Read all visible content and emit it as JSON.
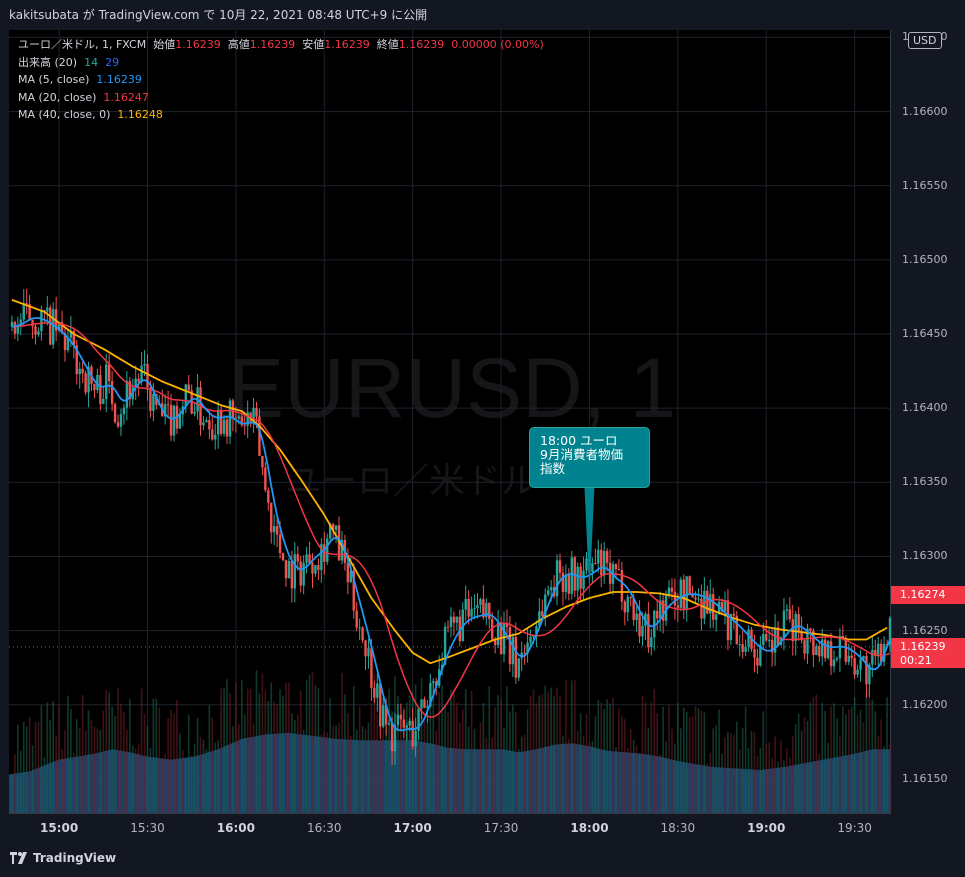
{
  "header": {
    "publish_line": "kakitsubata が TradingView.com で 10月 22, 2021 08:48 UTC+9 に公開"
  },
  "legend": {
    "symbol": "ユーロ／米ドル, 1, FXCM",
    "open_label": "始値",
    "open_value": "1.16239",
    "high_label": "高値",
    "high_value": "1.16239",
    "low_label": "安値",
    "low_value": "1.16239",
    "close_label": "終値",
    "close_value": "1.16239",
    "change_value": "0.00000 (0.00%)",
    "volume_label": "出来高 (20)",
    "volume_value1": "14",
    "volume_value2": "29",
    "ma5_label": "MA (5, close)",
    "ma5_value": "1.16239",
    "ma20_label": "MA (20, close)",
    "ma20_value": "1.16247",
    "ma40_label": "MA (40, close, 0)",
    "ma40_value": "1.16248"
  },
  "watermark": {
    "symbol": "EURUSD, 1",
    "name": "ユーロ／米ドル"
  },
  "annotation": {
    "line1": "18:00 ユーロ",
    "line2": "9月消費者物価",
    "line3": "指数"
  },
  "currency": "USD",
  "price_tags": {
    "last_high": "1.16274",
    "current": "1.16239",
    "countdown": "00:21"
  },
  "brand": {
    "name": "TradingView"
  },
  "colors": {
    "background": "#000000",
    "up": "#26a69a",
    "down": "#ef5350",
    "ma5": "#2196f3",
    "ma20": "#f23645",
    "ma40": "#ffb300",
    "volume_area": "#1e4a78",
    "annotation": "#00838f"
  },
  "chart_data": {
    "type": "candlestick",
    "title": "ユーロ／米ドル, 1, FXCM",
    "x_ticks": [
      "15:00",
      "15:30",
      "16:00",
      "16:30",
      "17:00",
      "17:30",
      "18:00",
      "18:30",
      "19:00",
      "19:30"
    ],
    "y_ticks": [
      "1.16650",
      "1.16600",
      "1.16550",
      "1.16500",
      "1.16450",
      "1.16400",
      "1.16350",
      "1.16300",
      "1.16250",
      "1.16200",
      "1.16150"
    ],
    "ylim": [
      1.16127,
      1.16655
    ],
    "xlim_minutes": [
      -17,
      282
    ],
    "close_path": [
      [
        -16,
        1.16455
      ],
      [
        -10,
        1.16462
      ],
      [
        -5,
        1.16458
      ],
      [
        0,
        1.1645
      ],
      [
        4,
        1.1644
      ],
      [
        8,
        1.16425
      ],
      [
        12,
        1.16412
      ],
      [
        16,
        1.16418
      ],
      [
        20,
        1.164
      ],
      [
        24,
        1.16415
      ],
      [
        28,
        1.16422
      ],
      [
        32,
        1.16402
      ],
      [
        36,
        1.1639
      ],
      [
        40,
        1.16398
      ],
      [
        44,
        1.1641
      ],
      [
        48,
        1.16398
      ],
      [
        52,
        1.16392
      ],
      [
        56,
        1.16396
      ],
      [
        60,
        1.16388
      ],
      [
        64,
        1.16392
      ],
      [
        67,
        1.16385
      ],
      [
        70,
        1.16345
      ],
      [
        74,
        1.1631
      ],
      [
        78,
        1.16292
      ],
      [
        81,
        1.1629
      ],
      [
        85,
        1.163
      ],
      [
        89,
        1.16305
      ],
      [
        92,
        1.16318
      ],
      [
        96,
        1.163
      ],
      [
        100,
        1.1627
      ],
      [
        104,
        1.1624
      ],
      [
        107,
        1.16215
      ],
      [
        110,
        1.1619
      ],
      [
        113,
        1.1618
      ],
      [
        116,
        1.16185
      ],
      [
        120,
        1.16182
      ],
      [
        123,
        1.16195
      ],
      [
        126,
        1.16212
      ],
      [
        129,
        1.1623
      ],
      [
        133,
        1.16248
      ],
      [
        137,
        1.16258
      ],
      [
        141,
        1.1626
      ],
      [
        145,
        1.16262
      ],
      [
        149,
        1.1625
      ],
      [
        152,
        1.1624
      ],
      [
        155,
        1.16228
      ],
      [
        159,
        1.16242
      ],
      [
        163,
        1.16262
      ],
      [
        167,
        1.16282
      ],
      [
        171,
        1.1629
      ],
      [
        175,
        1.16285
      ],
      [
        179,
        1.16288
      ],
      [
        183,
        1.16295
      ],
      [
        187,
        1.16285
      ],
      [
        191,
        1.1628
      ],
      [
        194,
        1.16268
      ],
      [
        197,
        1.16255
      ],
      [
        200,
        1.1625
      ],
      [
        204,
        1.16265
      ],
      [
        208,
        1.16272
      ],
      [
        212,
        1.16275
      ],
      [
        216,
        1.16274
      ],
      [
        220,
        1.1627
      ],
      [
        224,
        1.16262
      ],
      [
        228,
        1.16255
      ],
      [
        232,
        1.16247
      ],
      [
        236,
        1.16238
      ],
      [
        240,
        1.16235
      ],
      [
        244,
        1.16245
      ],
      [
        248,
        1.16255
      ],
      [
        252,
        1.1625
      ],
      [
        256,
        1.16242
      ],
      [
        260,
        1.16238
      ],
      [
        264,
        1.1624
      ],
      [
        268,
        1.16236
      ],
      [
        272,
        1.16228
      ],
      [
        275,
        1.1622
      ],
      [
        278,
        1.16232
      ],
      [
        281,
        1.16252
      ]
    ],
    "ma40_path": [
      [
        -16,
        1.16473
      ],
      [
        -5,
        1.16465
      ],
      [
        5,
        1.1645
      ],
      [
        15,
        1.1644
      ],
      [
        25,
        1.16428
      ],
      [
        35,
        1.16418
      ],
      [
        45,
        1.1641
      ],
      [
        55,
        1.16402
      ],
      [
        62,
        1.16398
      ],
      [
        68,
        1.16388
      ],
      [
        75,
        1.16372
      ],
      [
        82,
        1.16352
      ],
      [
        90,
        1.16328
      ],
      [
        98,
        1.163
      ],
      [
        106,
        1.16272
      ],
      [
        114,
        1.1625
      ],
      [
        120,
        1.16235
      ],
      [
        126,
        1.16228
      ],
      [
        132,
        1.16232
      ],
      [
        140,
        1.16238
      ],
      [
        148,
        1.16244
      ],
      [
        156,
        1.16248
      ],
      [
        164,
        1.16258
      ],
      [
        172,
        1.16266
      ],
      [
        180,
        1.16272
      ],
      [
        188,
        1.16276
      ],
      [
        196,
        1.16276
      ],
      [
        204,
        1.16275
      ],
      [
        212,
        1.16272
      ],
      [
        220,
        1.16265
      ],
      [
        228,
        1.16259
      ],
      [
        236,
        1.16254
      ],
      [
        244,
        1.16251
      ],
      [
        252,
        1.16249
      ],
      [
        260,
        1.16247
      ],
      [
        268,
        1.16244
      ],
      [
        274,
        1.16244
      ],
      [
        281,
        1.16252
      ]
    ],
    "volume_path": [
      [
        -17,
        1.16153
      ],
      [
        -10,
        1.16155
      ],
      [
        -4,
        1.1616
      ],
      [
        0,
        1.16163
      ],
      [
        6,
        1.16165
      ],
      [
        12,
        1.16167
      ],
      [
        18,
        1.1617
      ],
      [
        24,
        1.16168
      ],
      [
        30,
        1.16165
      ],
      [
        38,
        1.16163
      ],
      [
        46,
        1.16165
      ],
      [
        54,
        1.1617
      ],
      [
        62,
        1.16177
      ],
      [
        70,
        1.1618
      ],
      [
        78,
        1.16181
      ],
      [
        86,
        1.16179
      ],
      [
        94,
        1.16177
      ],
      [
        102,
        1.16176
      ],
      [
        108,
        1.16176
      ],
      [
        114,
        1.16176
      ],
      [
        120,
        1.16176
      ],
      [
        126,
        1.16174
      ],
      [
        132,
        1.16171
      ],
      [
        138,
        1.1617
      ],
      [
        144,
        1.1617
      ],
      [
        150,
        1.1617
      ],
      [
        156,
        1.16168
      ],
      [
        162,
        1.1617
      ],
      [
        168,
        1.16173
      ],
      [
        174,
        1.16174
      ],
      [
        180,
        1.16172
      ],
      [
        186,
        1.16169
      ],
      [
        192,
        1.16168
      ],
      [
        198,
        1.16167
      ],
      [
        204,
        1.16165
      ],
      [
        210,
        1.16162
      ],
      [
        216,
        1.1616
      ],
      [
        222,
        1.16158
      ],
      [
        230,
        1.16157
      ],
      [
        238,
        1.16156
      ],
      [
        246,
        1.16158
      ],
      [
        254,
        1.16161
      ],
      [
        262,
        1.16164
      ],
      [
        270,
        1.16167
      ],
      [
        276,
        1.1617
      ],
      [
        282,
        1.1617
      ]
    ],
    "event_minute": 180,
    "event_price": 1.16274,
    "last_high_price": 1.16274,
    "current_price": 1.16239
  }
}
